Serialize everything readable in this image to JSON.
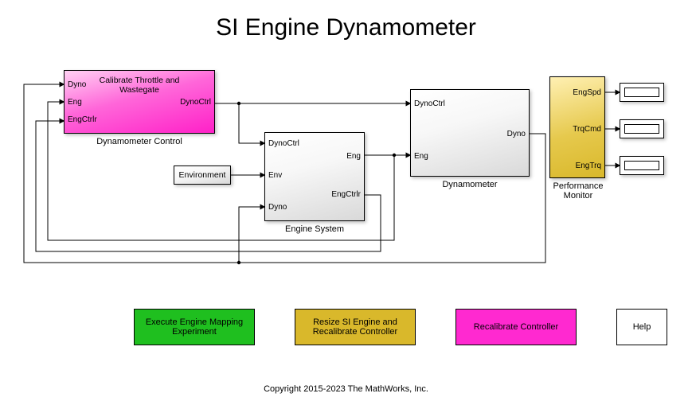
{
  "title": "SI Engine Dynamometer",
  "copyright": "Copyright 2015-2023 The MathWorks, Inc.",
  "blocks": {
    "dynoCtrl": {
      "label": "Dynamometer Control",
      "center": "Calibrate Throttle and\nWastegate",
      "ports": {
        "in": [
          "Dyno",
          "Eng",
          "EngCtrlr"
        ],
        "out": [
          "DynoCtrl"
        ]
      }
    },
    "engineSys": {
      "label": "Engine System",
      "ports": {
        "in": [
          "DynoCtrl",
          "Env",
          "Dyno"
        ],
        "out": [
          "Eng",
          "EngCtrlr"
        ]
      }
    },
    "environment": {
      "label": "Environment"
    },
    "dynamometer": {
      "label": "Dynamometer",
      "ports": {
        "in": [
          "DynoCtrl",
          "Eng"
        ],
        "out": [
          "Dyno"
        ]
      }
    },
    "perfMon": {
      "label": "Performance Monitor",
      "ports": {
        "out": [
          "EngSpd",
          "TrqCmd",
          "EngTrq"
        ]
      }
    }
  },
  "buttons": {
    "map": "Execute Engine Mapping\nExperiment",
    "resize": "Resize SI Engine and\nRecalibrate Controller",
    "recal": "Recalibrate Controller",
    "help": "Help"
  },
  "colors": {
    "magenta": "#ff21c8",
    "yellow": "#d9b82b",
    "green": "#1fbf1f",
    "magentaFlat": "#ff29d0"
  }
}
